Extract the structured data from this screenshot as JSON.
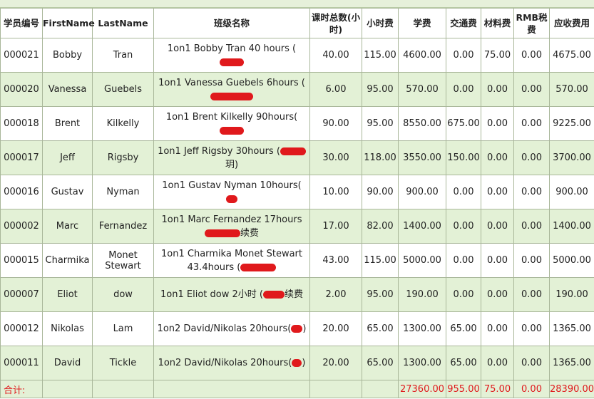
{
  "headers": {
    "id": "学员编号",
    "first": "FirstName",
    "last": "LastName",
    "class": "班级名称",
    "hours": "课时总数(小时)",
    "rate": "小时费",
    "tuition": "学费",
    "transport": "交通费",
    "material": "材料费",
    "tax": "RMB税费",
    "total": "应收费用"
  },
  "rows": [
    {
      "id": "000021",
      "first": "Bobby",
      "last": "Tran",
      "class": "1on1 Bobby Tran 40 hours (",
      "hours": "40.00",
      "rate": "115.00",
      "tuition": "4600.00",
      "transport": "0.00",
      "material": "75.00",
      "tax": "0.00",
      "total": "4675.00"
    },
    {
      "id": "000020",
      "first": "Vanessa",
      "last": "Guebels",
      "class": "1on1 Vanessa Guebels 6hours (",
      "hours": "6.00",
      "rate": "95.00",
      "tuition": "570.00",
      "transport": "0.00",
      "material": "0.00",
      "tax": "0.00",
      "total": "570.00"
    },
    {
      "id": "000018",
      "first": "Brent",
      "last": "Kilkelly",
      "class": "1on1 Brent Kilkelly 90hours(",
      "hours": "90.00",
      "rate": "95.00",
      "tuition": "8550.00",
      "transport": "675.00",
      "material": "0.00",
      "tax": "0.00",
      "total": "9225.00"
    },
    {
      "id": "000017",
      "first": "Jeff",
      "last": "Rigsby",
      "class": "1on1 Jeff Rigsby 30hours (",
      "hours": "30.00",
      "rate": "118.00",
      "tuition": "3550.00",
      "transport": "150.00",
      "material": "0.00",
      "tax": "0.00",
      "total": "3700.00"
    },
    {
      "id": "000016",
      "first": "Gustav",
      "last": "Nyman",
      "class": "1on1 Gustav Nyman 10hours(",
      "hours": "10.00",
      "rate": "90.00",
      "tuition": "900.00",
      "transport": "0.00",
      "material": "0.00",
      "tax": "0.00",
      "total": "900.00"
    },
    {
      "id": "000002",
      "first": "Marc",
      "last": "Fernandez",
      "class": "1on1 Marc Fernandez 17hours",
      "hours": "17.00",
      "rate": "82.00",
      "tuition": "1400.00",
      "transport": "0.00",
      "material": "0.00",
      "tax": "0.00",
      "total": "1400.00"
    },
    {
      "id": "000015",
      "first": "Charmika",
      "last": "Monet Stewart",
      "class": "1on1 Charmika Monet Stewart 43.4hours (",
      "hours": "43.00",
      "rate": "115.00",
      "tuition": "5000.00",
      "transport": "0.00",
      "material": "0.00",
      "tax": "0.00",
      "total": "5000.00"
    },
    {
      "id": "000007",
      "first": "Eliot",
      "last": "dow",
      "class": "1on1 Eliot dow 2小时 (",
      "hours": "2.00",
      "rate": "95.00",
      "tuition": "190.00",
      "transport": "0.00",
      "material": "0.00",
      "tax": "0.00",
      "total": "190.00"
    },
    {
      "id": "000012",
      "first": "Nikolas",
      "last": "Lam",
      "class": "1on2 David/Nikolas 20hours(",
      "hours": "20.00",
      "rate": "65.00",
      "tuition": "1300.00",
      "transport": "65.00",
      "material": "0.00",
      "tax": "0.00",
      "total": "1365.00"
    },
    {
      "id": "000011",
      "first": "David",
      "last": "Tickle",
      "class": "1on2 David/Nikolas 20hours(",
      "hours": "20.00",
      "rate": "65.00",
      "tuition": "1300.00",
      "transport": "65.00",
      "material": "0.00",
      "tax": "0.00",
      "total": "1365.00"
    }
  ],
  "class_tails": [
    "",
    "",
    "",
    "玥)",
    "",
    "续费",
    "",
    "续费",
    ")",
    ")"
  ],
  "totals": {
    "label": "合计:",
    "tuition": "27360.00",
    "transport": "955.00",
    "material": "75.00",
    "tax": "0.00",
    "total": "28390.00"
  }
}
